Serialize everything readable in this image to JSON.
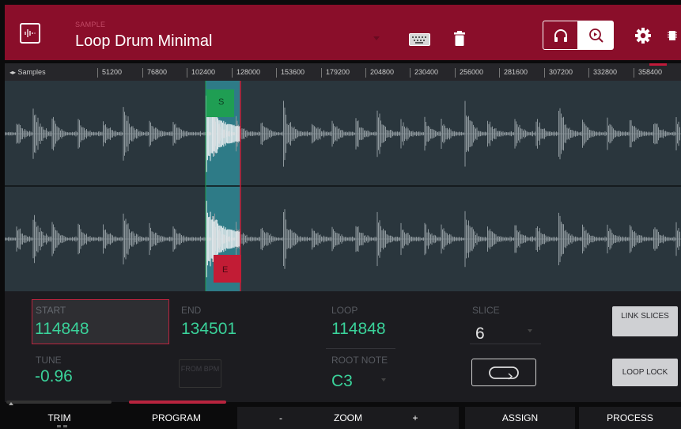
{
  "header": {
    "section_label": "SAMPLE",
    "sample_name": "Loop Drum Minimal",
    "icons": [
      "waveform-icon",
      "keyboard-icon",
      "trash-icon",
      "headphones-icon",
      "zoom-icon",
      "gear-icon",
      "chip-icon"
    ],
    "accent_color": "#8a0e2a"
  },
  "ruler": {
    "label": "Samples",
    "ticks": [
      "51200",
      "76800",
      "102400",
      "128000",
      "153600",
      "179200",
      "204800",
      "230400",
      "256000",
      "281600",
      "307200",
      "332800",
      "358400"
    ]
  },
  "waveform": {
    "start_marker": "S",
    "end_marker": "E"
  },
  "params": {
    "start": {
      "label": "START",
      "value": "114848"
    },
    "end": {
      "label": "END",
      "value": "134501"
    },
    "loop": {
      "label": "LOOP",
      "value": "114848"
    },
    "slice": {
      "label": "SLICE",
      "value": "6"
    },
    "tune": {
      "label": "TUNE",
      "value": "-0.96"
    },
    "from_bpm": "FROM BPM",
    "root_note": {
      "label": "ROOT NOTE",
      "value": "C3"
    },
    "link_slices": "LINK SLICES",
    "loop_lock": "LOOP LOCK"
  },
  "bottom_bar": {
    "trim": "TRIM",
    "program": "PROGRAM",
    "zoom_minus": "-",
    "zoom": "ZOOM",
    "zoom_plus": "+",
    "assign": "ASSIGN",
    "process": "PROCESS"
  }
}
